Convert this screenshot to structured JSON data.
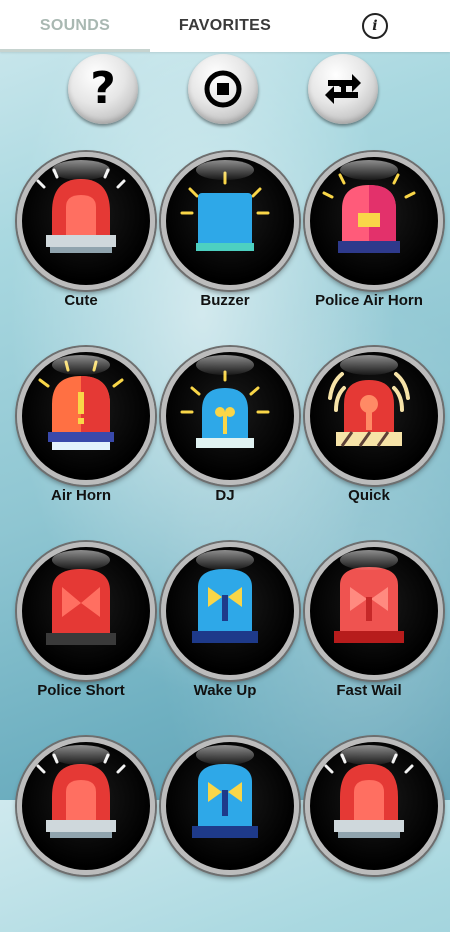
{
  "tabs": {
    "sounds": "SOUNDS",
    "favorites": "FAVORITES",
    "info_icon": "info-icon"
  },
  "controls": {
    "help_icon": "help-icon",
    "help_glyph": "?",
    "stop_icon": "stop-icon",
    "loop_icon": "repeat-one-icon"
  },
  "sounds": [
    {
      "label": "Cute",
      "icon": "red-siren-icon"
    },
    {
      "label": "Buzzer",
      "icon": "blue-buzzer-icon"
    },
    {
      "label": "Police Air Horn",
      "icon": "pink-siren-icon"
    },
    {
      "label": "Air Horn",
      "icon": "orange-alert-siren-icon"
    },
    {
      "label": "DJ",
      "icon": "blue-siren-icon"
    },
    {
      "label": "Quick",
      "icon": "red-striped-siren-icon"
    },
    {
      "label": "Police Short",
      "icon": "red-beacon-icon"
    },
    {
      "label": "Wake Up",
      "icon": "blue-beacon-icon"
    },
    {
      "label": "Fast Wail",
      "icon": "red-fast-beacon-icon"
    },
    {
      "label": "",
      "icon": "red-siren-icon"
    },
    {
      "label": "",
      "icon": "blue-beacon-icon"
    },
    {
      "label": "",
      "icon": "red-siren-icon"
    }
  ],
  "colors": {
    "tab_active": "#a9b8b2",
    "tab_inactive": "#3a3a3a",
    "disc_ring": "#bcbcbc",
    "siren_red": "#ee3b3b",
    "siren_blue": "#29a7e6"
  }
}
